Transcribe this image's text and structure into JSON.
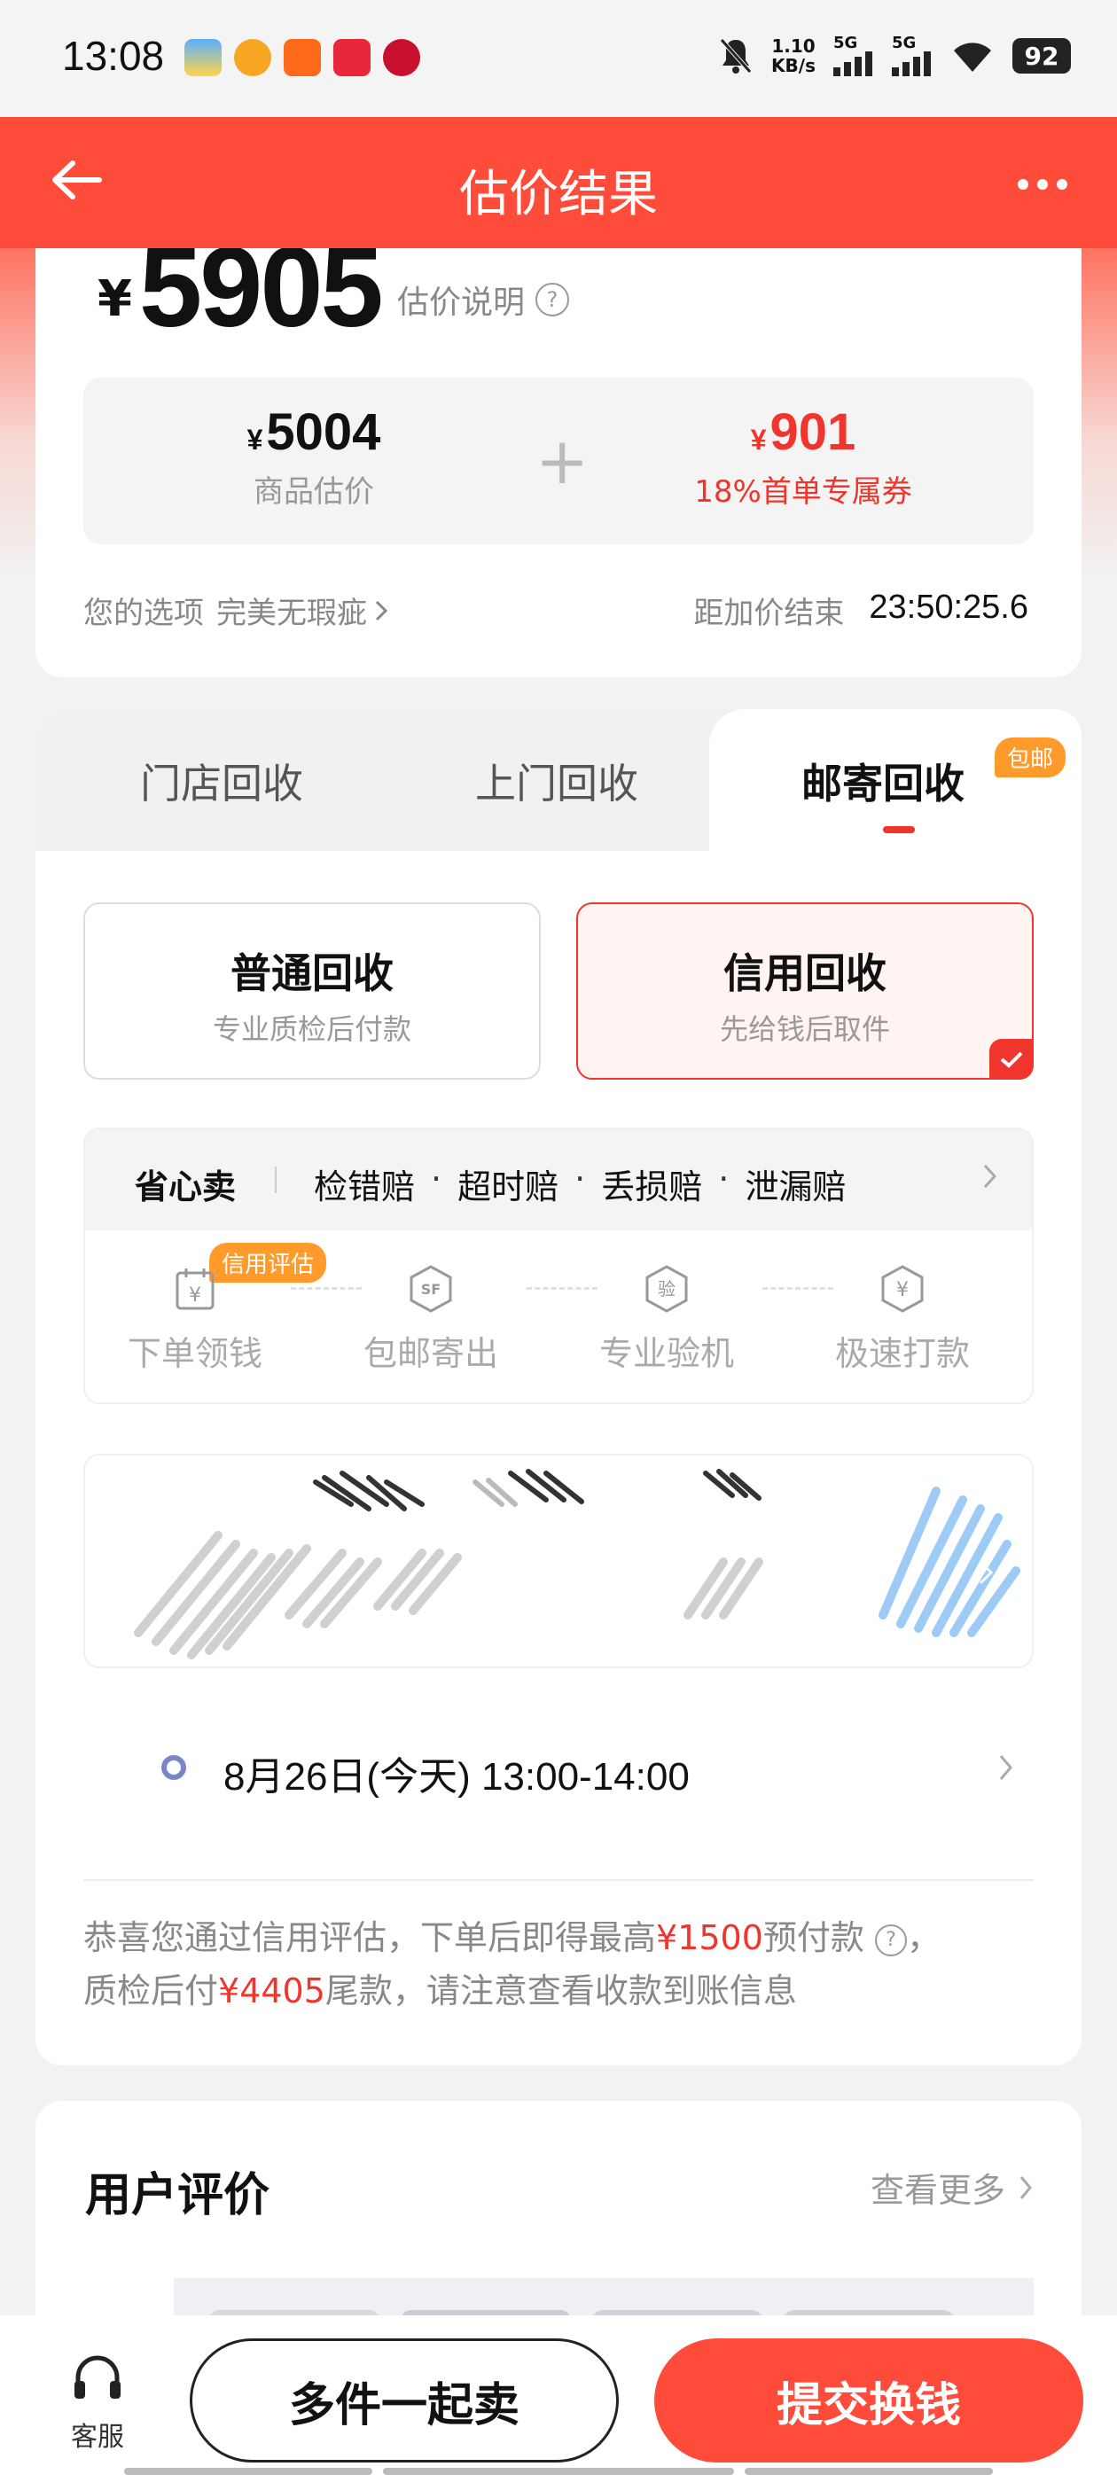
{
  "status_bar": {
    "time": "13:08",
    "net_speed_value": "1.10",
    "net_speed_unit": "KB/s",
    "sim1": "5G",
    "sim2": "5G",
    "battery": "92"
  },
  "nav": {
    "title": "估价结果"
  },
  "price": {
    "currency": "¥",
    "total": "5905",
    "note": "估价说明",
    "goods_value": "5004",
    "goods_label": "商品估价",
    "coupon_value": "901",
    "coupon_label": "18%首单专属券",
    "choice_label": "您的选项",
    "choice_value": "完美无瑕疵",
    "countdown_label": "距加价结束",
    "countdown_time": "23:50:25.6"
  },
  "tabs": {
    "items": [
      "门店回收",
      "上门回收",
      "邮寄回收"
    ],
    "active_badge": "包邮"
  },
  "recycle_types": [
    {
      "title": "普通回收",
      "subtitle": "专业质检后付款"
    },
    {
      "title": "信用回收",
      "subtitle": "先给钱后取件"
    }
  ],
  "worry_free": {
    "title": "省心卖",
    "items": [
      "检错赔",
      "超时赔",
      "丢损赔",
      "泄漏赔"
    ],
    "credit_badge": "信用评估",
    "steps": [
      "下单领钱",
      "包邮寄出",
      "专业验机",
      "极速打款"
    ]
  },
  "pickup_time": "8月26日(今天) 13:00-14:00",
  "note": {
    "p1": "恭喜您通过信用评估，下单后即得最高",
    "amount1": "¥1500",
    "p2": "预付款",
    "p3": "，",
    "p4": "质检后付",
    "amount2": "¥4405",
    "p5": "尾款，请注意查看收款到账信息"
  },
  "reviews": {
    "title": "用户评价",
    "more": "查看更多"
  },
  "bottom": {
    "service_label": "客服",
    "multi_button": "多件一起卖",
    "submit_button": "提交换钱"
  },
  "colors": {
    "brand_red": "#ff4b3a",
    "price_red": "#f0352c",
    "badge_orange": "#ff9a2b",
    "time_dot": "#7b86c9"
  }
}
